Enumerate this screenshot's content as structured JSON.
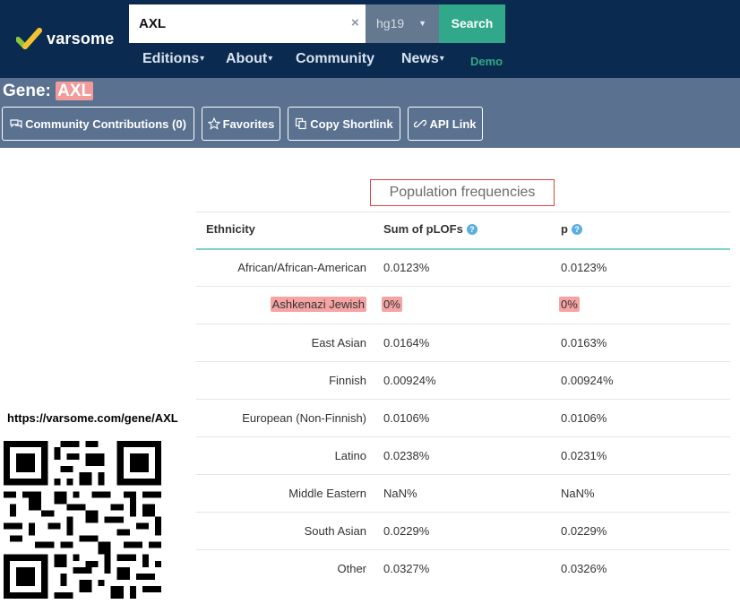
{
  "logo": {
    "text": "varsome"
  },
  "search": {
    "value": "AXL",
    "clear_icon": "×",
    "genome": "hg19",
    "button": "Search"
  },
  "nav": {
    "items": [
      "Editions",
      "About",
      "Community",
      "News"
    ],
    "dropdowns": [
      true,
      true,
      false,
      true
    ],
    "demo": "Demo"
  },
  "gene": {
    "prefix": "Gene:",
    "name": "AXL"
  },
  "toolbar": {
    "community": "Community Contributions (0)",
    "favorites": "Favorites",
    "copy": "Copy Shortlink",
    "api": "API Link"
  },
  "section_title": "Population frequencies",
  "table": {
    "headers": [
      "Ethnicity",
      "Sum of pLOFs",
      "p"
    ],
    "rows": [
      {
        "ethnicity": "African/African-American",
        "plof": "0.0123%",
        "p": "0.0123%"
      },
      {
        "ethnicity": "Ashkenazi Jewish",
        "plof": "0%",
        "p": "0%",
        "highlight": true
      },
      {
        "ethnicity": "East Asian",
        "plof": "0.0164%",
        "p": "0.0163%"
      },
      {
        "ethnicity": "Finnish",
        "plof": "0.00924%",
        "p": "0.00924%"
      },
      {
        "ethnicity": "European (Non-Finnish)",
        "plof": "0.0106%",
        "p": "0.0106%"
      },
      {
        "ethnicity": "Latino",
        "plof": "0.0238%",
        "p": "0.0231%"
      },
      {
        "ethnicity": "Middle Eastern",
        "plof": "NaN%",
        "p": "NaN%"
      },
      {
        "ethnicity": "South Asian",
        "plof": "0.0229%",
        "p": "0.0229%"
      },
      {
        "ethnicity": "Other",
        "plof": "0.0327%",
        "p": "0.0326%"
      }
    ]
  },
  "share": {
    "url": "https://varsome.com/gene/AXL"
  },
  "colors": {
    "navy": "#0b2a4f",
    "slate": "#5a7190",
    "teal": "#31a889",
    "highlight": "#f5a3a3"
  }
}
